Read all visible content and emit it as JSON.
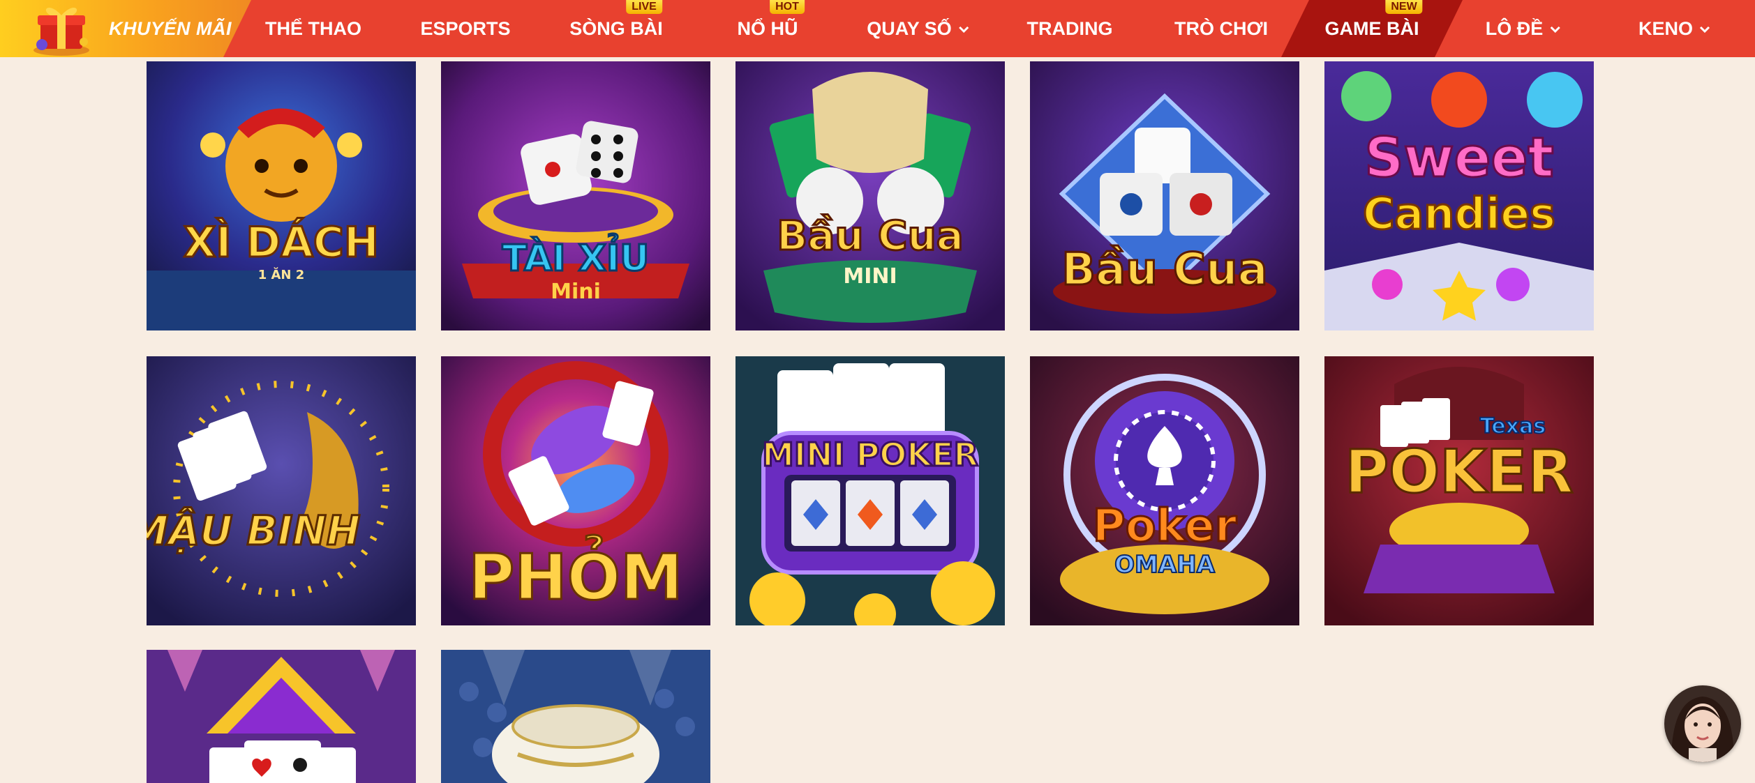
{
  "nav": {
    "promo_label": "KHUYẾN MÃI",
    "items": [
      {
        "label": "THỂ THAO"
      },
      {
        "label": "ESPORTS"
      },
      {
        "label": "SÒNG BÀI",
        "badge": "LIVE"
      },
      {
        "label": "NỔ HŨ",
        "badge": "HOT"
      },
      {
        "label": "QUAY SỐ",
        "dropdown": true
      },
      {
        "label": "TRADING"
      },
      {
        "label": "TRÒ CHƠI"
      },
      {
        "label": "GAME BÀI",
        "badge": "NEW",
        "active": true
      },
      {
        "label": "LÔ ĐỀ",
        "dropdown": true
      },
      {
        "label": "KENO",
        "dropdown": true
      }
    ]
  },
  "games": [
    {
      "name": "XÌ DÁCH",
      "sub": "1 ĂN 2"
    },
    {
      "name": "TÀI XỈU",
      "sub": "Mini"
    },
    {
      "name": "Bầu Cua",
      "sub": "MINI"
    },
    {
      "name": "Bầu Cua"
    },
    {
      "name": "Sweet",
      "sub": "Candies"
    },
    {
      "name": "MẬU BINH"
    },
    {
      "name": "PHỎM"
    },
    {
      "name": "MINI POKER"
    },
    {
      "name": "Poker",
      "sub": "OMAHA"
    },
    {
      "name": "POKER",
      "sub": "Texas"
    },
    {
      "name": ""
    },
    {
      "name": ""
    }
  ],
  "colors": {
    "nav_bg": "#e8412f",
    "active_bg": "#a8140f",
    "page_bg": "#f8ede2",
    "badge": "#f5b300"
  },
  "chat": {
    "icon": "support-avatar-icon"
  }
}
